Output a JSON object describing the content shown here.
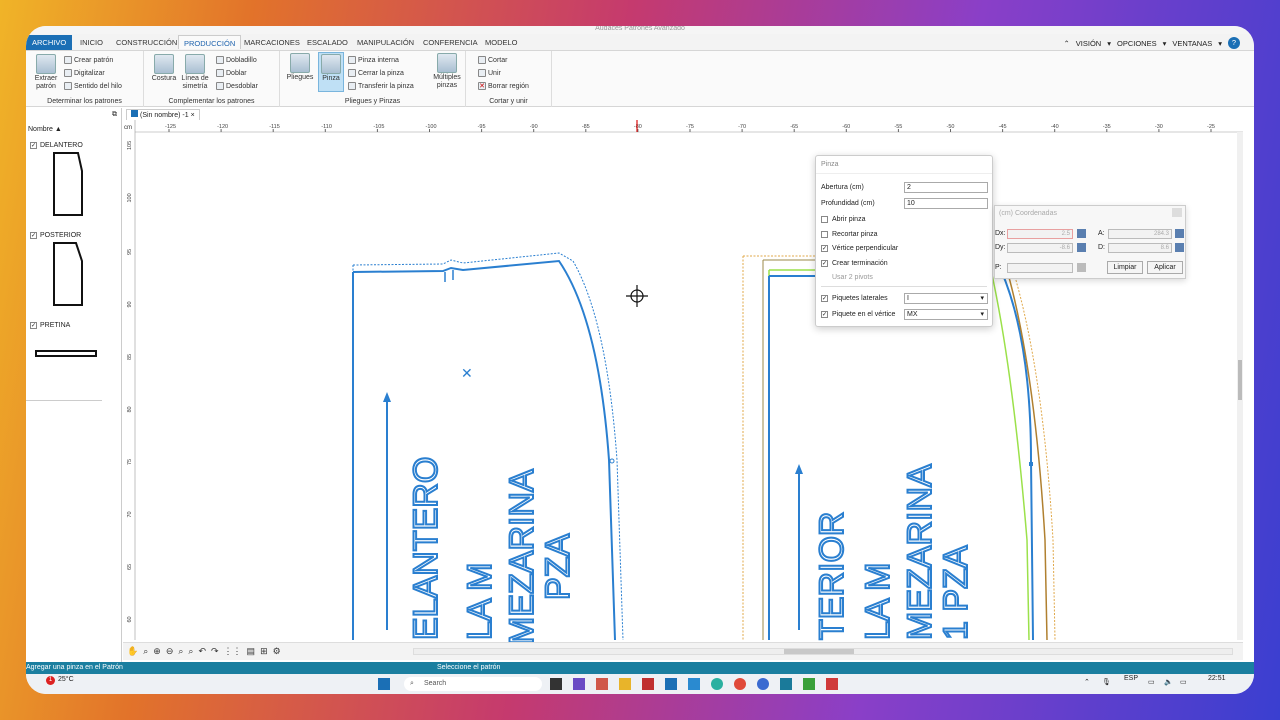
{
  "window": {
    "title": "Audaces Patrones Avanzado"
  },
  "tabs": [
    "ARCHIVO",
    "INICIO",
    "CONSTRUCCIÓN",
    "PRODUCCIÓN",
    "MARCACIONES",
    "ESCALADO",
    "MANIPULACIÓN",
    "CONFERENCIA",
    "MODELO"
  ],
  "right_tabs": [
    "VISIÓN",
    "OPCIONES",
    "VENTANAS"
  ],
  "ribbon": {
    "g1": {
      "extraer": "Extraer patrón",
      "crear": "Crear patrón",
      "digitalizar": "Digitalizar",
      "sentido": "Sentido del hilo",
      "label": "Determinar los patrones"
    },
    "g2": {
      "costura": "Costura",
      "linea": "Línea de simetría",
      "dobladillo": "Dobladillo",
      "doblar": "Doblar",
      "desdoblar": "Desdoblar",
      "label": "Complementar los patrones"
    },
    "g3": {
      "pliegues": "Pliegues",
      "pinza": "Pinza",
      "interna": "Pinza interna",
      "cerrar": "Cerrar la pinza",
      "transferir": "Transferir la pinza",
      "multiples": "Múltiples pinzas",
      "label": "Pliegues y Pinzas"
    },
    "g4": {
      "cortar": "Cortar",
      "unir": "Unir",
      "borrar": "Borrar región",
      "label": "Cortar y unir"
    }
  },
  "left_panel": {
    "header": "Nombre",
    "pieces": [
      "DELANTERO",
      "POSTERIOR",
      "PRETINA"
    ]
  },
  "doc_tab": "(Sin nombre) -1",
  "ruler": {
    "h": [
      "-125",
      "-120",
      "-115",
      "-110",
      "-105",
      "-100",
      "-95",
      "-90",
      "-85",
      "-80",
      "-75",
      "-70",
      "-65",
      "-60",
      "-55",
      "-50",
      "-45",
      "-40",
      "-35",
      "-30",
      "-25"
    ],
    "v": [
      "105",
      "100",
      "95",
      "90",
      "85",
      "80",
      "75",
      "70",
      "65",
      "60",
      "55"
    ]
  },
  "pattern_texts": {
    "a1": "ELANTERO",
    "a2": "LA M",
    "a3": "MEZARINA",
    "a4": "PZA",
    "b1": "TERIOR",
    "b2": "LA M",
    "b3": "MEZARINA",
    "b4": "1 PZA"
  },
  "pinza_dialog": {
    "title": "Pinza",
    "abertura_label": "Abertura (cm)",
    "abertura": "2",
    "profundidad_label": "Profundidad (cm)",
    "profundidad": "10",
    "abrir": "Abrir pinza",
    "recortar": "Recortar pinza",
    "vertice": "Vértice perpendicular",
    "crear": "Crear terminación",
    "usar": "Usar 2 pivots",
    "piquetes": "Piquetes laterales",
    "piquetes_val": "I",
    "piquete_v": "Piquete en el vértice",
    "piquete_v_val": "MX"
  },
  "coords_dialog": {
    "title": "(cm) Coordenadas",
    "dx": "Dx:",
    "dy": "Dy:",
    "a": "A:",
    "d": "D:",
    "p": "P:",
    "dx_val": "2.5",
    "dy_val": "-8.6",
    "a_val": "284.3",
    "d_val": "8.6",
    "limpiar": "Limpiar",
    "aplicar": "Aplicar"
  },
  "status": {
    "left": "Agregar una pinza en el Patrón",
    "mid": "Seleccione el patrón"
  },
  "taskbar": {
    "weather": "25°C",
    "search": "Search",
    "lang": "ESP",
    "time": "22:51"
  },
  "colors": {
    "accent": "#1b6fb5",
    "pattern": "#2a7fd0",
    "green": "#9be14a",
    "orange": "#e0a84a"
  }
}
